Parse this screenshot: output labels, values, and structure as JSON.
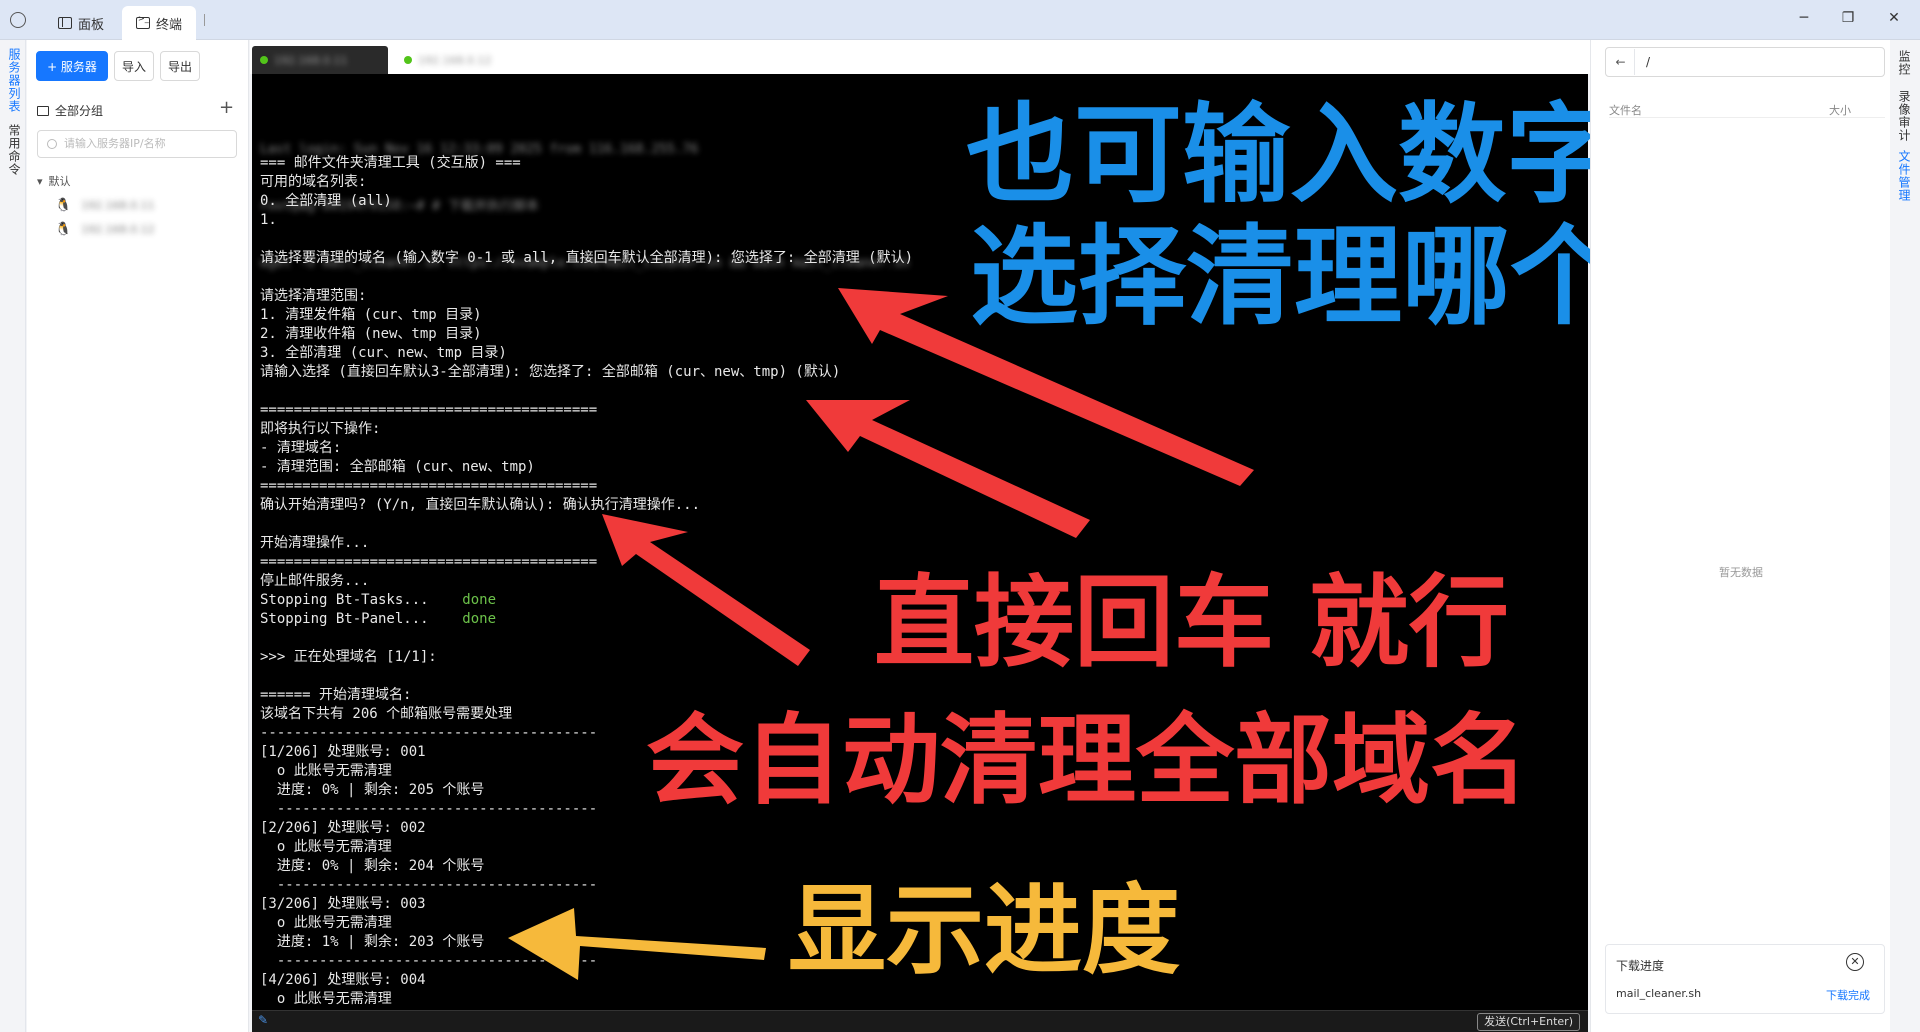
{
  "tabs": [
    {
      "label": "面板"
    },
    {
      "label": "终端"
    }
  ],
  "window_controls": {
    "minimize": "─",
    "restore": "❐",
    "close": "✕"
  },
  "left_rail": {
    "server_list": "服务器列表",
    "common_commands": "常用命令"
  },
  "sidebar": {
    "add_server": "+ 服务器",
    "import": "导入",
    "export": "导出",
    "group_all": "全部分组",
    "add_group": "+",
    "search_placeholder": "请输入服务器IP/名称",
    "group_default": "默认",
    "servers": [
      {
        "name": "192.168.0.11"
      },
      {
        "name": "192.168.0.12"
      }
    ]
  },
  "terminal_tabs": [
    {
      "label": "192.168.0.11"
    },
    {
      "label": "192.168.0.12"
    }
  ],
  "terminal": {
    "blur_lines": [
      "Last login: Sun Nov 16 12:33:09 2025 from 116.168.255.76",
      "root@ag-8019479158:~# # 下载并执行脚本",
      "wget -O mail_cleaner.sh https://example.com/mail_cleaner.sh && bash mail_cleaner.sh"
    ],
    "lines": [
      "=== 邮件文件夹清理工具 (交互版) ===",
      "可用的域名列表:",
      "0. 全部清理 (all)",
      "1. ",
      "",
      "请选择要清理的域名 (输入数字 0-1 或 all, 直接回车默认全部清理): 您选择了: 全部清理 (默认)",
      "",
      "请选择清理范围:",
      "1. 清理发件箱 (cur、tmp 目录)",
      "2. 清理收件箱 (new、tmp 目录)",
      "3. 全部清理 (cur、new、tmp 目录)",
      "请输入选择 (直接回车默认3-全部清理): 您选择了: 全部邮箱 (cur、new、tmp) (默认)",
      "",
      "========================================",
      "即将执行以下操作:",
      "- 清理域名: ",
      "- 清理范围: 全部邮箱 (cur、new、tmp)",
      "========================================",
      "确认开始清理吗? (Y/n, 直接回车默认确认): 确认执行清理操作...",
      "",
      "开始清理操作...",
      "========================================",
      "停止邮件服务...",
      "Stopping Bt-Tasks...",
      "Stopping Bt-Panel...",
      "",
      ">>> 正在处理域名 [1/1]: ",
      "",
      "====== 开始清理域名: ",
      "该域名下共有 206 个邮箱账号需要处理",
      "----------------------------------------",
      "[1/206] 处理账号: 001",
      "  o 此账号无需清理",
      "  进度: 0% | 剩余: 205 个账号",
      "  --------------------------------------",
      "[2/206] 处理账号: 002",
      "  o 此账号无需清理",
      "  进度: 0% | 剩余: 204 个账号",
      "  --------------------------------------",
      "[3/206] 处理账号: 003",
      "  o 此账号无需清理",
      "  进度: 1% | 剩余: 203 个账号",
      "  --------------------------------------",
      "[4/206] 处理账号: 004",
      "  o 此账号无需清理"
    ],
    "done_text": "done",
    "send_button": "发送(Ctrl+Enter)"
  },
  "annotations": {
    "blue_line1": "也可输入数字",
    "blue_line2": "选择清理哪个",
    "red_line1": "直接回车 就行",
    "red_line2": "会自动清理全部域名",
    "yellow": "显示进度",
    "blue_color": "#1a8fe8",
    "red_color": "#f03a3a",
    "yellow_color": "#f6b93b"
  },
  "file_panel": {
    "path": "/",
    "col_name": "文件名",
    "col_size": "大小",
    "empty": "暂无数据",
    "download_title": "下载进度",
    "download_file": "mail_cleaner.sh",
    "download_status": "下载完成"
  },
  "right_rail": {
    "monitor": "监控",
    "audit": "录像审计",
    "file_manager": "文件管理"
  }
}
